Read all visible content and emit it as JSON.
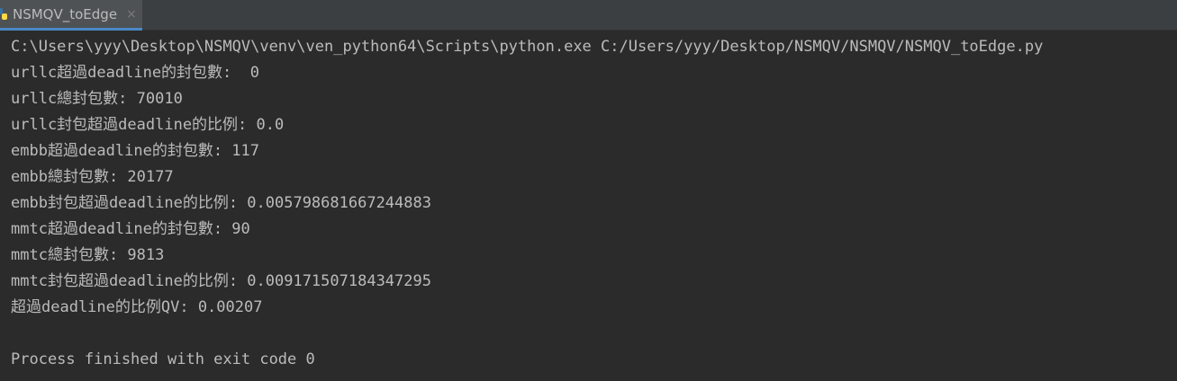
{
  "tab": {
    "title": "NSMQV_toEdge",
    "close_glyph": "×",
    "icon": "python-file-icon"
  },
  "console": {
    "command": "C:\\Users\\yyy\\Desktop\\NSMQV\\venv\\ven_python64\\Scripts\\python.exe C:/Users/yyy/Desktop/NSMQV/NSMQV/NSMQV_toEdge.py",
    "lines": [
      "urllc超過deadline的封包數:  0",
      "urllc總封包數: 70010",
      "urllc封包超過deadline的比例: 0.0",
      "embb超過deadline的封包數: 117",
      "embb總封包數: 20177",
      "embb封包超過deadline的比例: 0.005798681667244883",
      "mmtc超過deadline的封包數: 90",
      "mmtc總封包數: 9813",
      "mmtc封包超過deadline的比例: 0.009171507184347295",
      "超過deadline的比例QV: 0.00207"
    ],
    "exit_message": "Process finished with exit code 0"
  },
  "colors": {
    "background": "#2b2b2b",
    "text": "#bbbbbb",
    "tab_active_underline": "#4a88c7"
  }
}
